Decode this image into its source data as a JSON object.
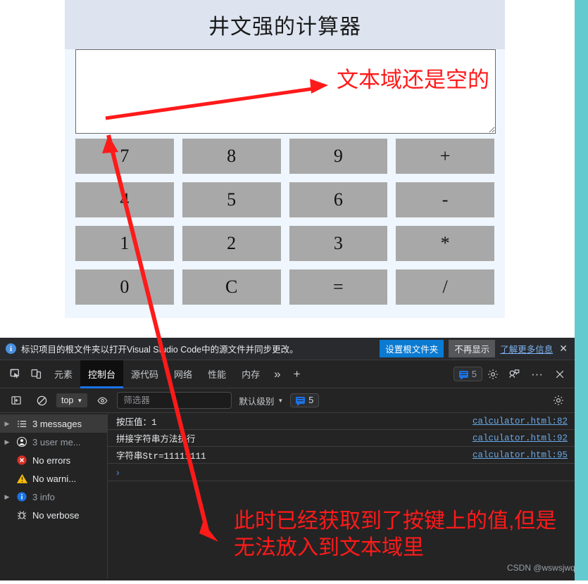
{
  "page": {
    "calculator": {
      "title": "井文强的计算器",
      "display_value": "",
      "display_placeholder": "",
      "buttons": [
        "7",
        "8",
        "9",
        "+",
        "4",
        "5",
        "6",
        "-",
        "1",
        "2",
        "3",
        "*",
        "0",
        "C",
        "=",
        "/"
      ],
      "header_bg": "#dde4f0",
      "body_bg": "#eff6fd",
      "button_bg": "#a8a8a8"
    },
    "annotations": {
      "textarea_note": "文本域还是空的",
      "console_note": "此时已经获取到了按键上的值,但是无法放入到文本域里",
      "color": "#ff1a1a"
    },
    "watermark": "CSDN @wswsjwq",
    "accent_teal": "#63cbd0"
  },
  "devtools": {
    "infobar": {
      "icon": "info-icon",
      "message": "标识项目的根文件夹以打开Visual Studio Code中的源文件并同步更改。",
      "primary_button": "设置根文件夹",
      "secondary_button": "不再显示",
      "link": "了解更多信息",
      "close": "✕"
    },
    "tabbar": {
      "inspect_icon": "inspect-element-icon",
      "device_icon": "device-toolbar-icon",
      "tabs": [
        {
          "label": "元素",
          "active": false
        },
        {
          "label": "控制台",
          "active": true
        },
        {
          "label": "源代码",
          "active": false
        },
        {
          "label": "网络",
          "active": false
        },
        {
          "label": "性能",
          "active": false
        },
        {
          "label": "内存",
          "active": false
        }
      ],
      "overflow": "»",
      "add_tab": "+",
      "message_count": "5",
      "settings_icon": "gear-icon",
      "feedback_icon": "feedback-icon",
      "more_icon": "···",
      "close_icon": "✕"
    },
    "console_toolbar": {
      "sidebar_toggle_icon": "sidebar-toggle-icon",
      "clear_icon": "clear-console-icon",
      "context": "top",
      "eye_icon": "live-expression-icon",
      "filter_placeholder": "筛选器",
      "filter_value": "",
      "level": "默认级别",
      "level_count": "5",
      "settings_icon": "gear-icon"
    },
    "sidebar": [
      {
        "label": "3 messages",
        "icon": "list-icon",
        "expandable": true,
        "selected": true,
        "dim": false
      },
      {
        "label": "3 user me...",
        "icon": "user-icon",
        "expandable": true,
        "selected": false,
        "dim": true
      },
      {
        "label": "No errors",
        "icon": "error-icon",
        "expandable": false,
        "selected": false,
        "dim": false
      },
      {
        "label": "No warni...",
        "icon": "warning-icon",
        "expandable": false,
        "selected": false,
        "dim": false
      },
      {
        "label": "3 info",
        "icon": "info-icon",
        "expandable": true,
        "selected": false,
        "dim": true
      },
      {
        "label": "No verbose",
        "icon": "bug-icon",
        "expandable": false,
        "selected": false,
        "dim": false
      }
    ],
    "logs": [
      {
        "message": "按压值：1",
        "source": "calculator.html:82"
      },
      {
        "message": "拼接字符串方法执行",
        "source": "calculator.html:92"
      },
      {
        "message": "字符串Str=11111111",
        "source": "calculator.html:95"
      }
    ],
    "prompt": "›"
  }
}
